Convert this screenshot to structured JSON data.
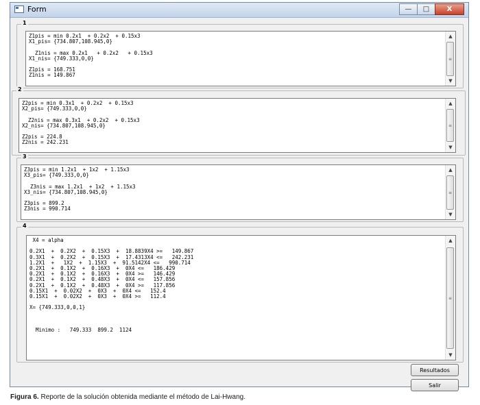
{
  "window": {
    "title": "Form",
    "minimize_glyph": "—",
    "maximize_glyph": "□",
    "close_glyph": "X"
  },
  "groups": [
    {
      "label": "1",
      "text": "Z1pis = min 0.2x1  + 0.2x2  + 0.15x3\nX1_pis= {734.807,108.945,0}\n\n  Z1nis = max 0.2x1   + 0.2x2   + 0.15x3\nX1_nis= {749.333,0,0}\n\nZ1pis = 168.751\nZ1nis = 149.867"
    },
    {
      "label": "2",
      "text": "Z2pis = min 0.3x1  + 0.2x2  + 0.15x3\nX2_pis= {749.333,0,0}\n\n  Z2nis = max 0.3x1  + 0.2x2  + 0.15x3\nX2_nis= {734.807,108.945,0}\n\nZ2pis = 224.8\nZ2nis = 242.231"
    },
    {
      "label": "3",
      "text": "Z3pis = min 1.2x1  + 1x2  + 1.15x3\nX3_pis= {749.333,0,0}\n\n  Z3nis = max 1.2x1  + 1x2  + 1.15x3\nX3_nis= {734.807,108.945,0}\n\nZ3pis = 899.2\nZ3nis = 990.714"
    },
    {
      "label": "4",
      "text": " X4 = alpha\n\n0.2X1  +  0.2X2  +  0.15X3  +  18.8839X4 >=   149.867\n0.3X1  +  0.2X2  +  0.15X3  +  17.4313X4 <=   242.231\n1.2X1  +   1X2  +  1.15X3  +  91.5142X4 <=   990.714\n0.2X1  +  0.1X2  +  0.16X3  +  0X4 <=   186.429\n0.2X1  +  0.1X2  +  0.16X3  +  0X4 >=   146.429\n0.2X1  +  0.1X2  +  0.48X3  +  0X4 <=   157.856\n0.2X1  +  0.1X2  +  0.48X3  +  0X4 >=   117.856\n0.15X1  +  0.02X2  +  0X3  +  0X4 <=   152.4\n0.15X1  +  0.02X2  +  0X3  +  0X4 >=   112.4\n\nX= {749.333,0,0,1}\n\n\n\n  Minimo :   749.333  899.2  1124"
    }
  ],
  "buttons": {
    "results": "Resultados",
    "exit": "Salir"
  },
  "caption": {
    "label": "Figura 6.",
    "text": " Reporte de la solución obtenida mediante el método de Lai-Hwang."
  },
  "icons": {
    "scroll_up": "▲",
    "scroll_down": "▼",
    "grip": "≡"
  }
}
